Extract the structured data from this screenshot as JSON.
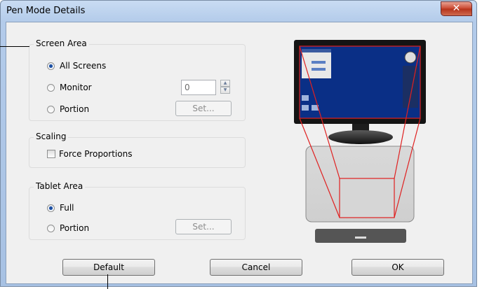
{
  "window": {
    "title": "Pen Mode Details",
    "close_symbol": "✕"
  },
  "screen_area": {
    "label": "Screen Area",
    "all_screens_label": "All Screens",
    "monitor_label": "Monitor",
    "portion_label": "Portion",
    "monitor_value": "0",
    "set_label": "Set...",
    "selected": "All Screens"
  },
  "scaling": {
    "label": "Scaling",
    "force_proportions_label": "Force Proportions",
    "force_proportions_checked": false
  },
  "tablet_area": {
    "label": "Tablet Area",
    "full_label": "Full",
    "portion_label": "Portion",
    "set_label": "Set...",
    "selected": "Full"
  },
  "buttons": {
    "default_label": "Default",
    "cancel_label": "Cancel",
    "ok_label": "OK"
  },
  "colors": {
    "mapping_lines": "#e02020",
    "desktop": "#0a2f86",
    "monitor_frame": "#141414"
  }
}
